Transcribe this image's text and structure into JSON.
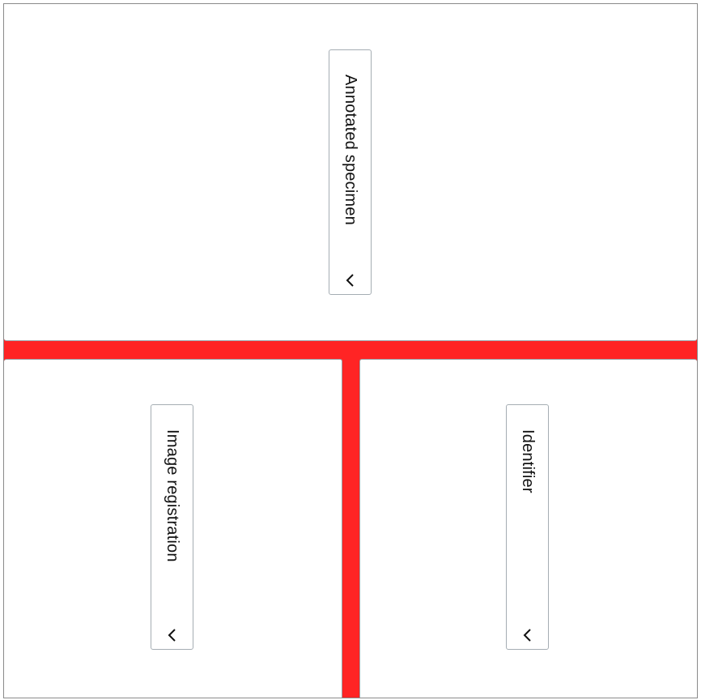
{
  "layout_colors": {
    "divider": "#ff2424",
    "panel_bg": "#ffffff",
    "border": "#9aa0a6"
  },
  "panels": {
    "top": {
      "select_label": "Annotated specimen",
      "icon": "chevron-left-icon"
    },
    "bottom_left": {
      "select_label": "Image registration",
      "icon": "chevron-left-icon"
    },
    "bottom_right": {
      "select_label": "Identifier",
      "icon": "chevron-left-icon"
    }
  }
}
